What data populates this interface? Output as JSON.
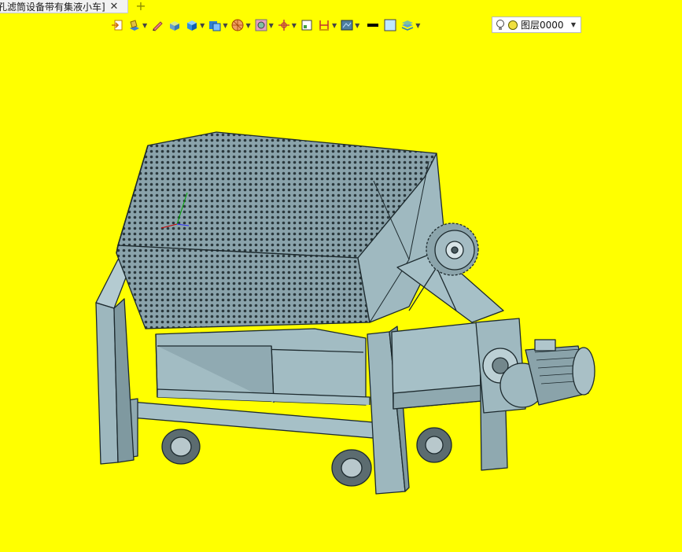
{
  "tab": {
    "title": "孔滤筒设备带有集液小车]",
    "close_glyph": "✕",
    "add_glyph": "+"
  },
  "toolbar": {
    "buttons": [
      "exit-sketch-icon",
      "sketch-plane-icon",
      "pen-icon",
      "solid-box-icon",
      "blue-cube-icon",
      "shaded-view-icon",
      "section-view-icon",
      "wireframe-icon",
      "point-snap-icon",
      "frame-icon",
      "dimension-icon",
      "display-style-icon",
      "line-weight-icon",
      "fill-color-icon",
      "layer-stack-icon"
    ]
  },
  "layer": {
    "icons": [
      "lightbulb-icon",
      "status-dot-icon"
    ],
    "value": "图层0000"
  },
  "colors": {
    "background": "#ffff00",
    "model_fill": "#96b0b8",
    "model_edge": "#1d2a2e"
  }
}
